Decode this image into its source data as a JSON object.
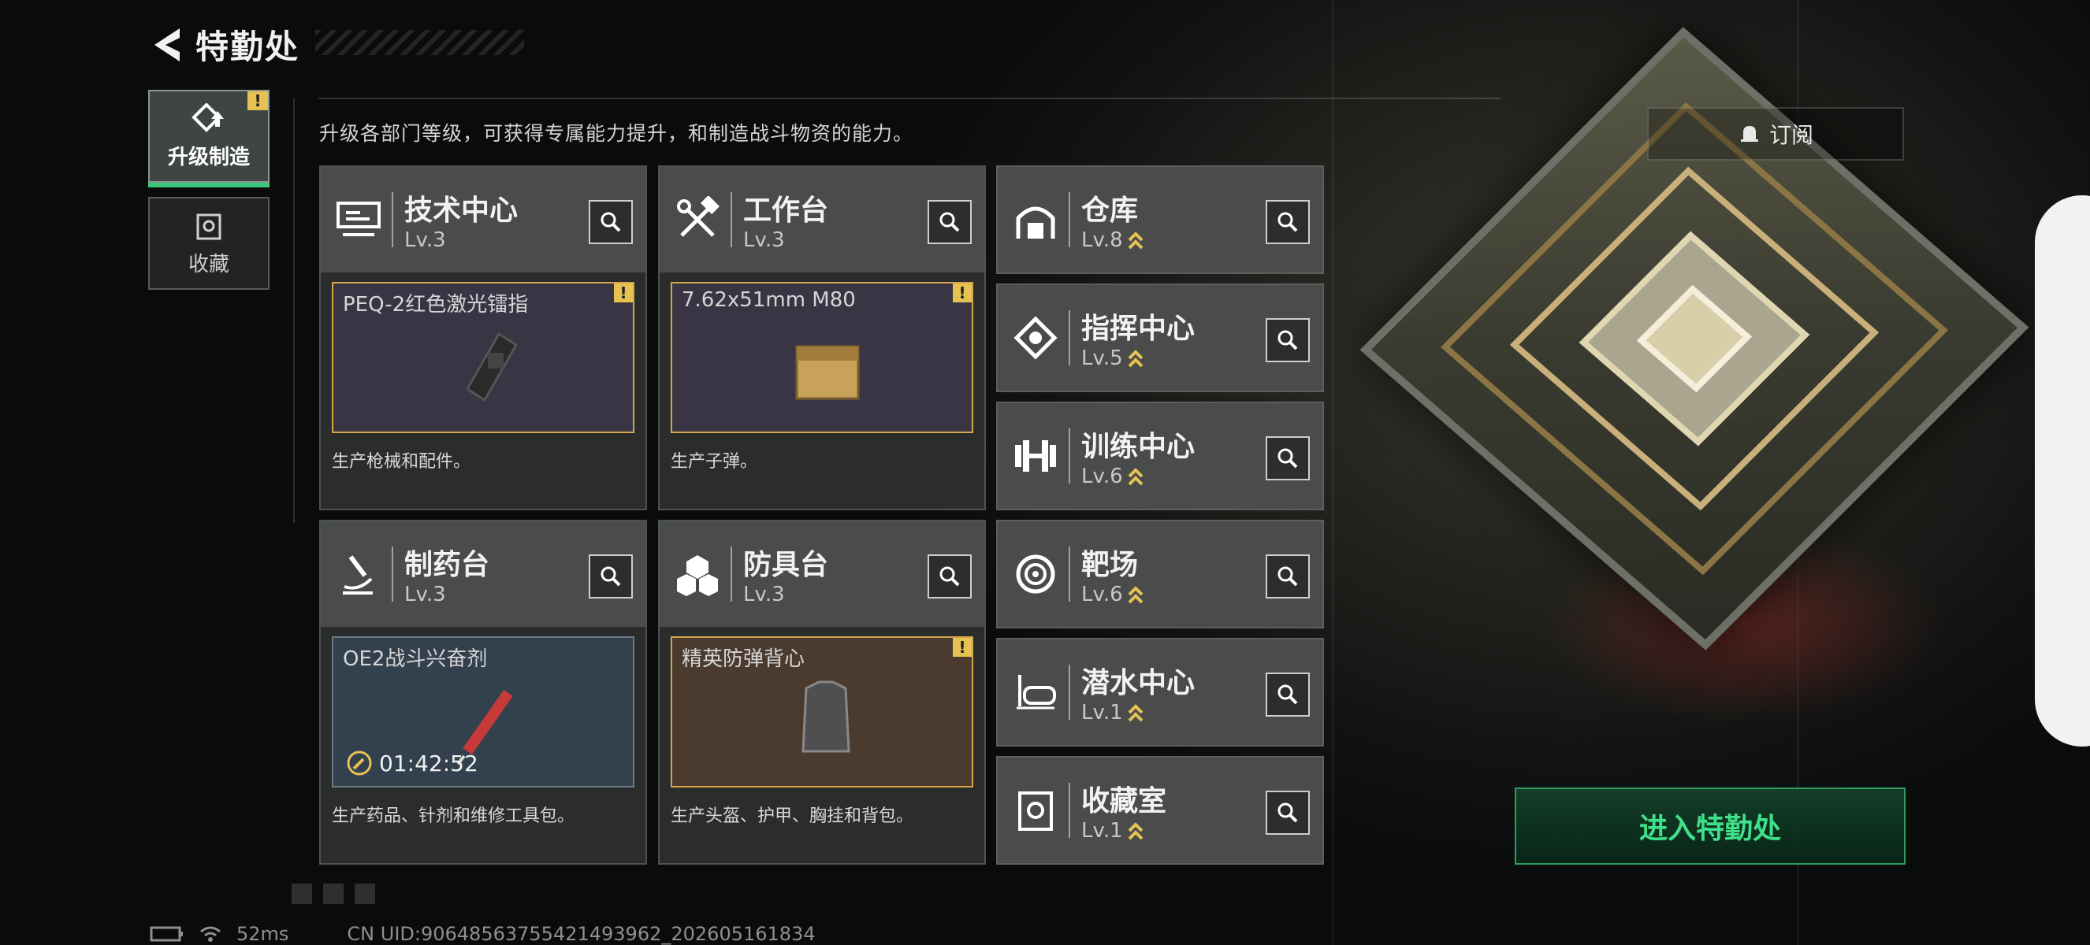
{
  "header": {
    "title": "特勤处"
  },
  "tabs": [
    {
      "label": "升级制造",
      "active": true,
      "alert": "!"
    },
    {
      "label": "收藏",
      "active": false
    }
  ],
  "description": "升级各部门等级，可获得专属能力提升，和制造战斗物资的能力。",
  "subscribe": {
    "label": "订阅"
  },
  "enter": {
    "label": "进入特勤处"
  },
  "facilities_main": [
    {
      "name": "技术中心",
      "level": "Lv.3",
      "icon": "circuit-board-icon",
      "product": {
        "name": "PEQ-2红色激光镭指",
        "alert": "!",
        "color": "purple"
      },
      "desc": "生产枪械和配件。"
    },
    {
      "name": "工作台",
      "level": "Lv.3",
      "icon": "hammer-wrench-icon",
      "product": {
        "name": "7.62x51mm M80",
        "alert": "!",
        "color": "purple"
      },
      "desc": "生产子弹。"
    },
    {
      "name": "制药台",
      "level": "Lv.3",
      "icon": "microscope-icon",
      "product": {
        "name": "OE2战斗兴奋剂",
        "timer": "01:42:52",
        "color": "blue"
      },
      "desc": "生产药品、针剂和维修工具包。"
    },
    {
      "name": "防具台",
      "level": "Lv.3",
      "icon": "armor-blocks-icon",
      "product": {
        "name": "精英防弹背心",
        "alert": "!",
        "color": "brown"
      },
      "desc": "生产头盔、护甲、胸挂和背包。"
    }
  ],
  "facilities_side": [
    {
      "name": "仓库",
      "level": "Lv.8",
      "icon": "warehouse-icon"
    },
    {
      "name": "指挥中心",
      "level": "Lv.5",
      "icon": "command-chip-icon"
    },
    {
      "name": "训练中心",
      "level": "Lv.6",
      "icon": "dumbbell-icon"
    },
    {
      "name": "靶场",
      "level": "Lv.6",
      "icon": "target-icon"
    },
    {
      "name": "潜水中心",
      "level": "Lv.1",
      "icon": "diving-mask-icon"
    },
    {
      "name": "收藏室",
      "level": "Lv.1",
      "icon": "collection-icon"
    }
  ],
  "status": {
    "ping": "52ms",
    "uid": "CN UID:9064856375542149396​2_202605161834"
  },
  "colors": {
    "accent_green": "#39c77b",
    "alert_yellow": "#e6c253",
    "product_border": "#d5a74a"
  }
}
